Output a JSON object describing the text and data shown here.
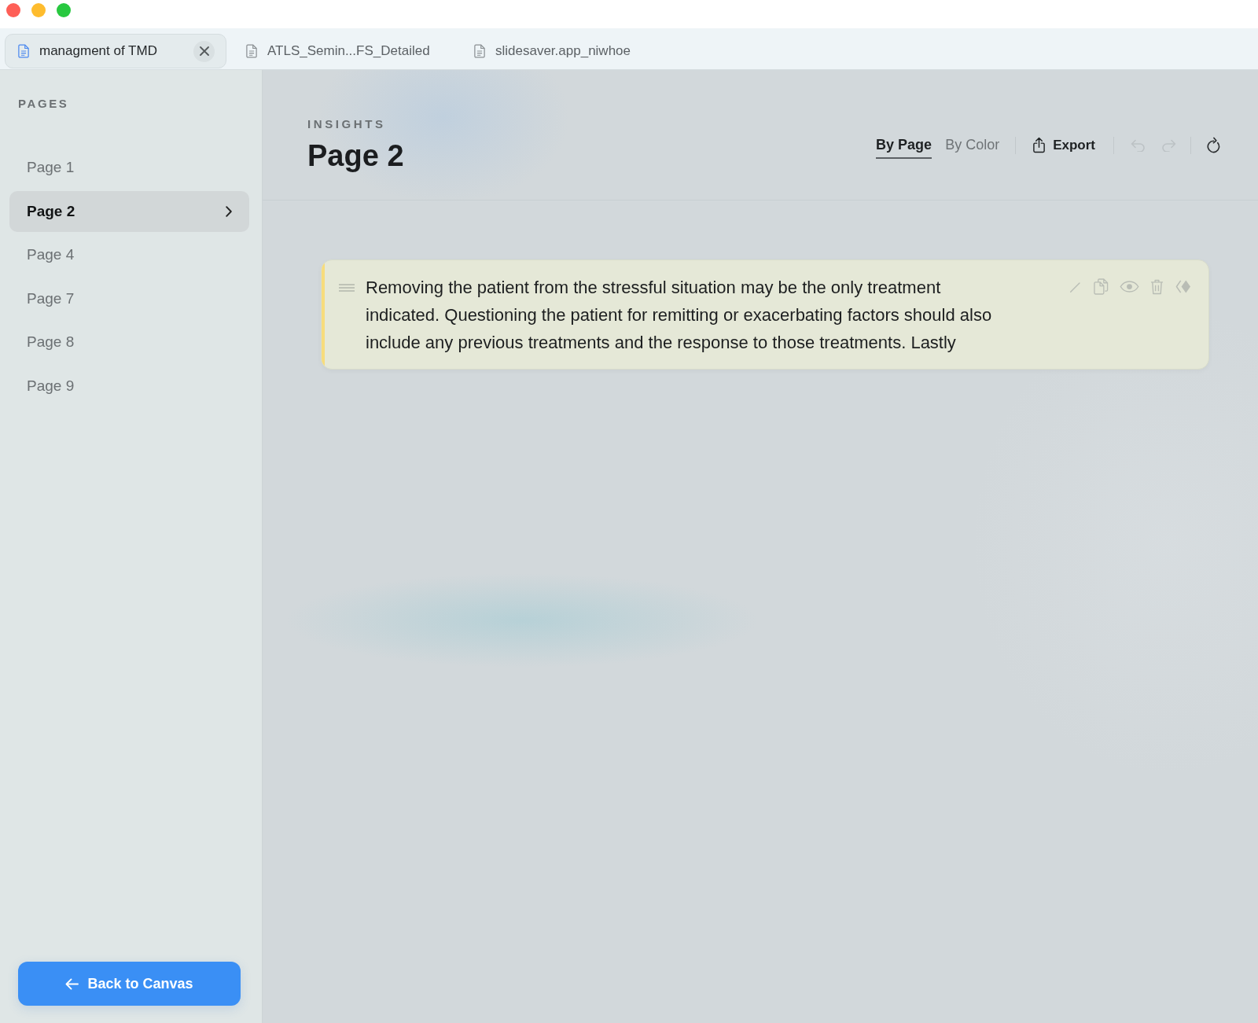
{
  "tabs": [
    {
      "label": "managment of TMD",
      "selected": true
    },
    {
      "label": "ATLS_Semin...FS_Detailed",
      "selected": false
    },
    {
      "label": "slidesaver.app_niwhoe",
      "selected": false
    }
  ],
  "sidebar": {
    "heading": "PAGES",
    "items": [
      {
        "label": "Page 1",
        "selected": false
      },
      {
        "label": "Page 2",
        "selected": true
      },
      {
        "label": "Page 4",
        "selected": false
      },
      {
        "label": "Page 7",
        "selected": false
      },
      {
        "label": "Page 8",
        "selected": false
      },
      {
        "label": "Page 9",
        "selected": false
      }
    ],
    "back_button": "Back to Canvas"
  },
  "header": {
    "eyebrow": "INSIGHTS",
    "title": "Page 2",
    "view_toggle": [
      {
        "label": "By Page",
        "selected": true
      },
      {
        "label": "By Color",
        "selected": false
      }
    ],
    "export": "Export",
    "undo": {
      "disabled": true
    },
    "redo": {
      "disabled": true
    }
  },
  "highlights": [
    {
      "text": "Removing the patient from the stressful situation may be the only treatment indicated. Questioning the patient for remitting or exacerbating factors should also include any previous treatments and the response to those treatments. Lastly",
      "color": "#f7dc7c"
    }
  ]
}
